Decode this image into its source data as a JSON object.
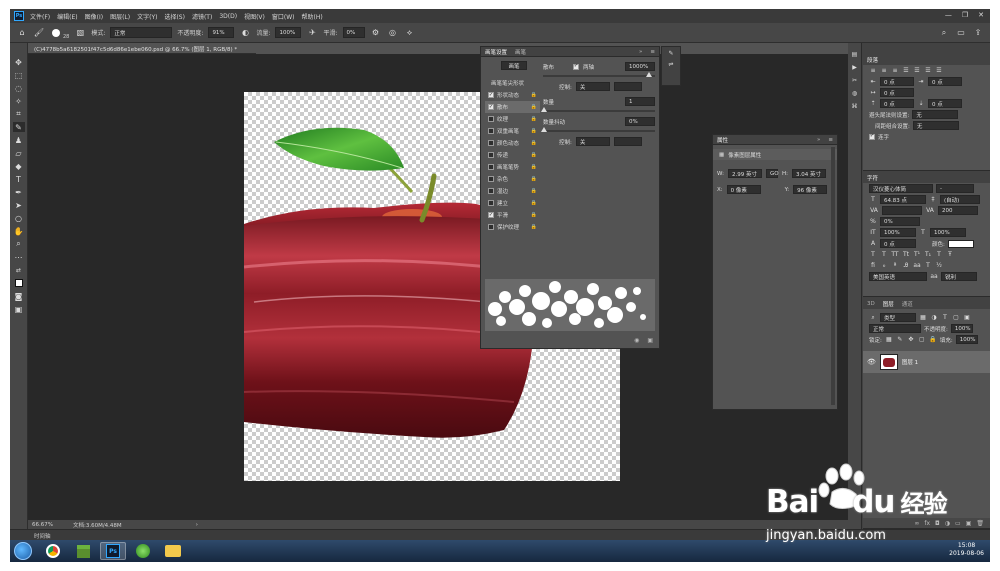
{
  "menubar": {
    "logo": "Ps",
    "items": [
      "文件(F)",
      "编辑(E)",
      "图像(I)",
      "图层(L)",
      "文字(Y)",
      "选择(S)",
      "滤镜(T)",
      "3D(D)",
      "视图(V)",
      "窗口(W)",
      "帮助(H)"
    ]
  },
  "options": {
    "brush_size": "28",
    "mode_label": "模式:",
    "mode_value": "正常",
    "opacity_label": "不透明度:",
    "opacity_value": "91%",
    "flow_label": "流量:",
    "flow_value": "100%",
    "smooth_label": "平滑:",
    "smooth_value": "0%"
  },
  "document": {
    "tab_title": "(C)4778b5a6182501f47c5d6d86e1ebe060.psd @ 66.7% (图层 1, RGB/8) *",
    "zoom": "66.67%",
    "doc_info": "文档:3.60M/4.48M"
  },
  "timeline": {
    "label": "时间轴"
  },
  "brush_settings": {
    "tabs": [
      "画笔设置",
      "画笔"
    ],
    "preset_button": "画笔",
    "tip_shape": "画笔笔尖形状",
    "items": [
      {
        "label": "形状动态",
        "checked": true
      },
      {
        "label": "散布",
        "checked": true
      },
      {
        "label": "纹理",
        "checked": false
      },
      {
        "label": "双重画笔",
        "checked": false
      },
      {
        "label": "颜色动态",
        "checked": false
      },
      {
        "label": "传递",
        "checked": false
      },
      {
        "label": "画笔笔势",
        "checked": false
      },
      {
        "label": "杂色",
        "checked": false
      },
      {
        "label": "湿边",
        "checked": false
      },
      {
        "label": "建立",
        "checked": false
      },
      {
        "label": "平滑",
        "checked": true
      },
      {
        "label": "保护纹理",
        "checked": false
      }
    ],
    "scatter_label": "散布",
    "both_axes_label": "两轴",
    "scatter_value": "1000%",
    "control_label": "控制:",
    "control_value": "关",
    "count_label": "数量",
    "count_value": "1",
    "count_jitter_label": "数量抖动",
    "count_jitter_value": "0%",
    "control2_label": "控制:",
    "control2_value": "关"
  },
  "properties": {
    "title": "属性",
    "subtitle": "像素图层属性",
    "w_label": "W:",
    "w_value": "2.99 英寸",
    "link_label": "GO",
    "h_label": "H:",
    "h_value": "3.04 英寸",
    "x_label": "X:",
    "x_value": "0 像素",
    "y_label": "Y:",
    "y_value": "96 像素"
  },
  "paragraph": {
    "title": "段落",
    "indent_left": "0 点",
    "indent_right": "0 点",
    "first_line": "0 点",
    "space_before": "0 点",
    "space_after": "0 点",
    "kinsoku_label": "避头尾法则设置:",
    "kinsoku_value": "无",
    "mojikumi_label": "间距组合设置:",
    "mojikumi_value": "无",
    "hyphenate_label": "连字"
  },
  "character": {
    "title": "字符",
    "font_family": "汉仪菱心体简",
    "font_style": "-",
    "font_size": "64.83 点",
    "leading": "(自动)",
    "kerning_label": "VA",
    "tracking_label": "VA",
    "tracking_value": "200",
    "scale_label": "%",
    "scale_value": "0%",
    "vscale": "100%",
    "hscale": "100%",
    "baseline": "0 点",
    "color_label": "颜色:",
    "language": "美国英语",
    "antialias": "锐利"
  },
  "layers": {
    "tabs": [
      "3D",
      "图层",
      "通道"
    ],
    "filter_label": "类型",
    "blend_mode": "正常",
    "opacity_label": "不透明度:",
    "opacity_value": "100%",
    "lock_label": "锁定:",
    "fill_label": "填充:",
    "fill_value": "100%",
    "layer_name": "图层 1"
  },
  "taskbar": {
    "time": "15:08",
    "date": "2019-08-06"
  },
  "watermark": {
    "brand": "Bai",
    "brand2": "du",
    "cn": "经验",
    "url": "jingyan.baidu.com"
  }
}
